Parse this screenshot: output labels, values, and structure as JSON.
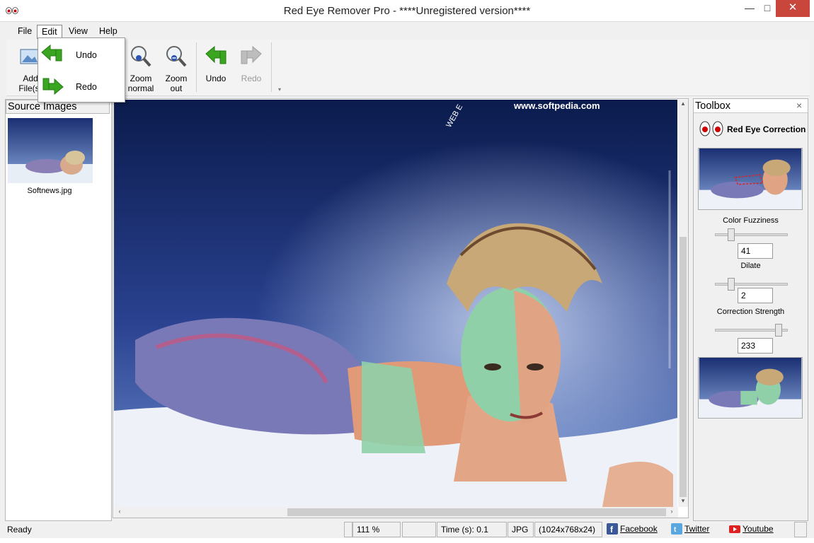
{
  "window": {
    "title": "Red Eye Remover Pro - ****Unregistered version****",
    "minimize": "—",
    "maximize": "□",
    "close": "✕"
  },
  "menu": {
    "file": "File",
    "edit": "Edit",
    "view": "View",
    "help": "Help"
  },
  "edit_menu": {
    "undo": "Undo",
    "redo": "Redo"
  },
  "toolbar": {
    "add_files_line1": "Add",
    "add_files_line2": "File(s)",
    "zoom_normal_line1": "Zoom",
    "zoom_normal_line2": "normal",
    "zoom_out_line1": "Zoom",
    "zoom_out_line2": "out",
    "undo": "Undo",
    "redo": "Redo",
    "overflow": "▾"
  },
  "source_panel": {
    "title": "Source Images",
    "items": [
      {
        "filename": "Softnews.jpg"
      }
    ]
  },
  "canvas": {
    "watermark": "www.softpedia.com",
    "rotated_text": "WEB E"
  },
  "scrollbars": {
    "up": "▴",
    "down": "▾",
    "left": "‹",
    "right": "›"
  },
  "toolbox": {
    "title": "Toolbox",
    "close": "×",
    "section": "Red Eye Correction",
    "color_fuzziness_label": "Color Fuzziness",
    "color_fuzziness_value": "41",
    "color_fuzziness_slider": 0.18,
    "dilate_label": "Dilate",
    "dilate_value": "2",
    "dilate_slider": 0.18,
    "correction_strength_label": "Correction Strength",
    "correction_strength_value": "233",
    "correction_strength_slider": 0.9
  },
  "statusbar": {
    "status": "Ready",
    "zoom": "111 %",
    "empty": "",
    "time": "Time (s): 0.1",
    "format": "JPG",
    "dimensions": "(1024x768x24)",
    "facebook": "Facebook",
    "twitter": "Twitter",
    "youtube": "Youtube"
  },
  "colors": {
    "close_button": "#c9463d",
    "canvas_sky_top": "#0b1b4d",
    "canvas_sky_bottom": "#4a6bb5",
    "skin_tint": "#8fd0a8",
    "arrow_green": "#3aa520"
  }
}
